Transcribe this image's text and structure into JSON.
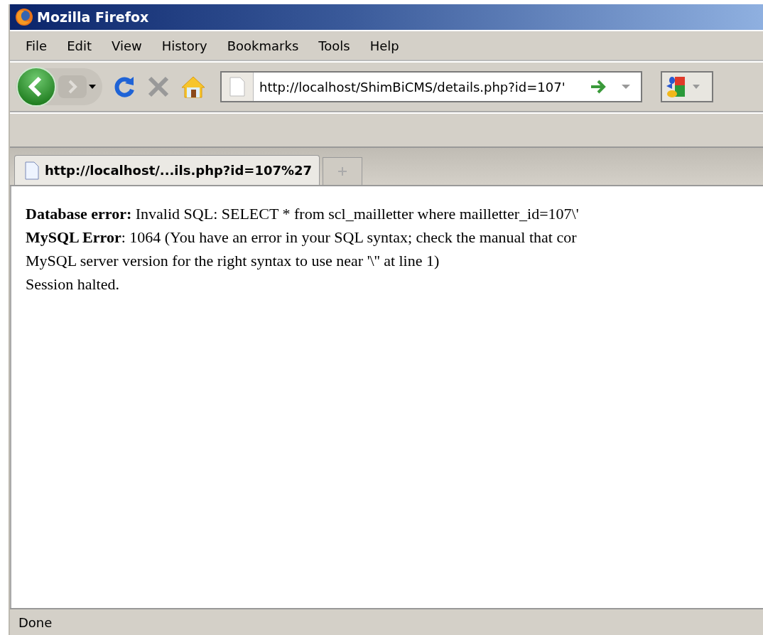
{
  "window": {
    "title": "Mozilla Firefox"
  },
  "menu": [
    {
      "label": "File"
    },
    {
      "label": "Edit"
    },
    {
      "label": "View"
    },
    {
      "label": "History"
    },
    {
      "label": "Bookmarks"
    },
    {
      "label": "Tools"
    },
    {
      "label": "Help"
    }
  ],
  "address_bar": {
    "value": "http://localhost/ShimBiCMS/details.php?id=107'"
  },
  "tabs": [
    {
      "label": "http://localhost/...ils.php?id=107%27",
      "selected": true
    }
  ],
  "content": [
    "**Database error:** Invalid SQL: SELECT * from scl_mailletter where mailletter_id=107\\'",
    "**MySQL Error**: 1064 (You have an error in your SQL syntax; check the manual that cor",
    "MySQL server version for the right syntax to use near '\\'' at line 1)",
    "Session halted."
  ],
  "status_bar": "Done"
}
